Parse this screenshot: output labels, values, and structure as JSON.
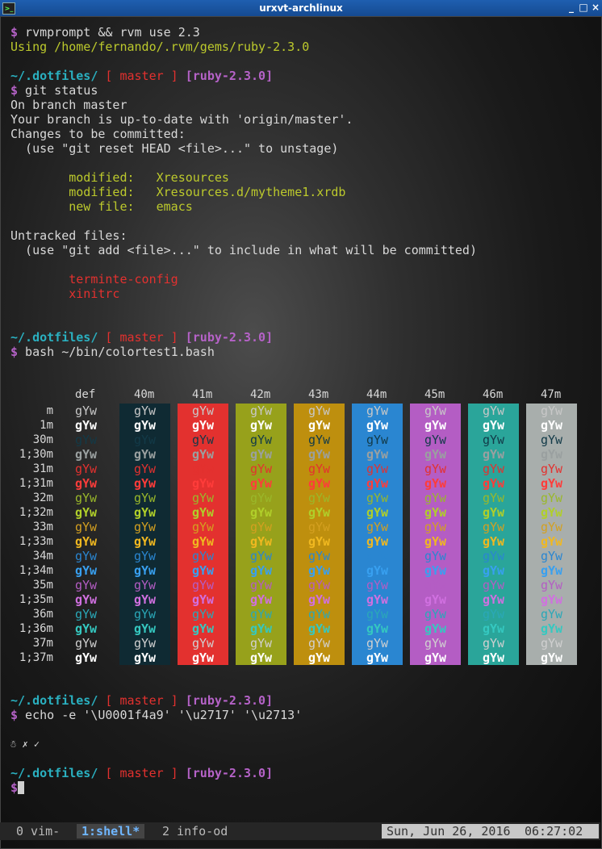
{
  "window": {
    "title": "urxvt-archlinux",
    "controls": [
      "_",
      "□",
      "×"
    ]
  },
  "term": {
    "l1": {
      "prompt": "$",
      "cmd": " rvmprompt && rvm use 2.3"
    },
    "l2": "Using /home/fernando/.rvm/gems/ruby-2.3.0",
    "ps1": {
      "dir": "~/.dotfiles/",
      "branch": "[ master ]",
      "ruby": "[ruby-2.3.0]"
    },
    "l4": {
      "prompt": "$",
      "cmd": " git status"
    },
    "gs": [
      "On branch master",
      "Your branch is up-to-date with 'origin/master'.",
      "Changes to be committed:",
      "  (use \"git reset HEAD <file>...\" to unstage)"
    ],
    "staged": [
      "        modified:   Xresources",
      "        modified:   Xresources.d/mytheme1.xrdb",
      "        new file:   emacs"
    ],
    "untracked_title": "Untracked files:",
    "untracked_hint": "  (use \"git add <file>...\" to include in what will be committed)",
    "untracked": [
      "        terminte-config",
      "        xinitrc"
    ],
    "l_ct": {
      "prompt": "$",
      "cmd": " bash ~/bin/colortest1.bash"
    },
    "l_echo": {
      "prompt": "$",
      "cmd": " echo -e '\\U0001f4a9' '\\u2717' '\\u2713'"
    },
    "echo_out": "☃ ✗ ✓",
    "last_prompt": "$"
  },
  "colortest": {
    "sample": "gYw",
    "col_headers": [
      "def",
      "40m",
      "41m",
      "42m",
      "43m",
      "44m",
      "45m",
      "46m",
      "47m"
    ],
    "row_labels": [
      "m",
      "1m",
      "30m",
      "1;30m",
      "31m",
      "1;31m",
      "32m",
      "1;32m",
      "33m",
      "1;33m",
      "34m",
      "1;34m",
      "35m",
      "1;35m",
      "36m",
      "1;36m",
      "37m",
      "1;37m"
    ],
    "bg_colors": [
      "transparent",
      "#0f2a33",
      "#e3312f",
      "#97a11b",
      "#be8f0e",
      "#2a86d1",
      "#b45dc4",
      "#2aa59a",
      "#a8aeac"
    ],
    "fg_colors": [
      "#c8c8c8",
      "#0f2a33",
      "#e3312f",
      "#9ab82a",
      "#d4a020",
      "#2a86d1",
      "#b45dc4",
      "#2aa8b8",
      "#d0d0d0"
    ],
    "bright_fg": [
      "#ffffff",
      "#0f2a33",
      "#ff3c3a",
      "#b0cf2a",
      "#f0b820",
      "#38a0f0",
      "#d070e0",
      "#35c8c0",
      "#ffffff"
    ]
  },
  "statusbar": {
    "windows": [
      {
        "label": "0 vim-",
        "active": false
      },
      {
        "label": "1:shell*",
        "active": true
      },
      {
        "label": "2 info-od",
        "active": false
      }
    ],
    "date": "Sun, Jun 26, 2016",
    "time": "06:27:02"
  }
}
